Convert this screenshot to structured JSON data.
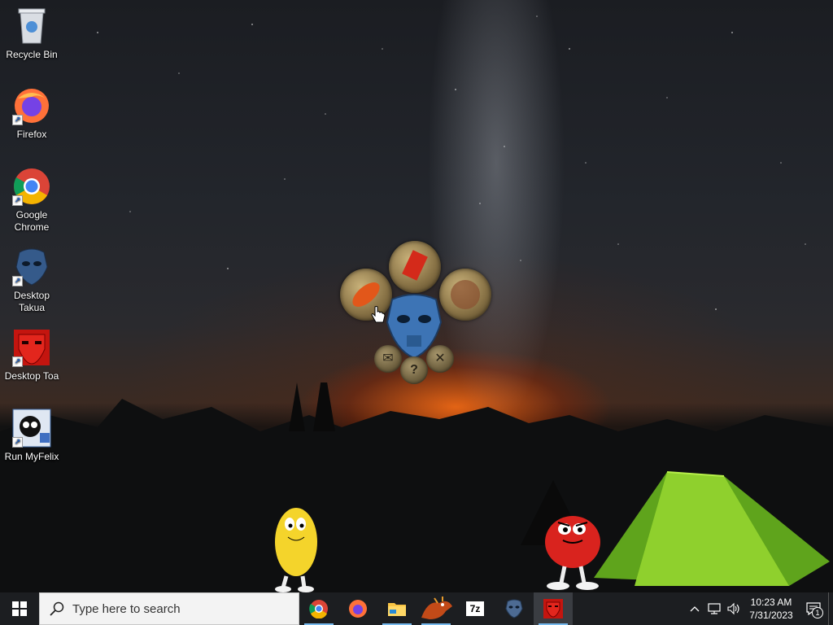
{
  "desktop": {
    "icons": [
      {
        "label": "Recycle Bin",
        "icon": "recycle-bin-icon"
      },
      {
        "label": "Firefox",
        "icon": "firefox-icon"
      },
      {
        "label": "Google Chrome",
        "icon": "chrome-icon"
      },
      {
        "label": "Desktop Takua",
        "icon": "takua-mask-icon"
      },
      {
        "label": "Desktop Toa",
        "icon": "toa-mask-icon"
      },
      {
        "label": "Run MyFelix",
        "icon": "myfelix-icon"
      }
    ],
    "widget": {
      "orbs": [
        "fire-orb-icon",
        "red-mask-orb-icon",
        "stone-orb-icon",
        "blue-mask-center-icon"
      ],
      "buttons": [
        "mail-icon",
        "help-icon",
        "close-icon"
      ]
    },
    "characters": [
      "yellow-mascot",
      "red-mascot"
    ]
  },
  "taskbar": {
    "search_placeholder": "Type here to search",
    "apps": [
      "chrome-icon",
      "firefox-icon",
      "file-explorer-icon",
      "dragon-app-icon",
      "7zip-icon",
      "takua-mask-icon",
      "toa-mask-icon"
    ],
    "seven_zip_label": "7z",
    "clock": {
      "time": "10:23 AM",
      "date": "7/31/2023"
    },
    "notification_count": "1"
  },
  "colors": {
    "taskbar": "#1c1e21",
    "search": "#f3f3f3",
    "accent": "#76b9ed"
  }
}
